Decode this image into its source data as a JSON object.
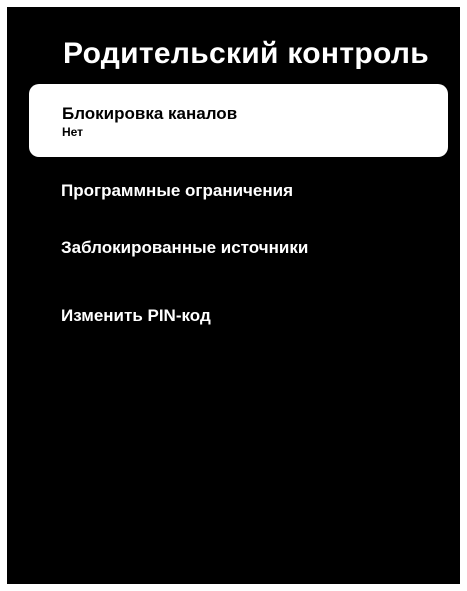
{
  "header": {
    "title": "Родительский контроль"
  },
  "menu": {
    "items": [
      {
        "label": "Блокировка каналов",
        "value": "Нет"
      },
      {
        "label": "Программные ограничения"
      },
      {
        "label": "Заблокированные источники"
      },
      {
        "label": "Изменить PIN-код"
      }
    ]
  },
  "colors": {
    "background": "#000000",
    "selection": "#ffffff",
    "text": "#ffffff",
    "selected_text": "#000000"
  }
}
